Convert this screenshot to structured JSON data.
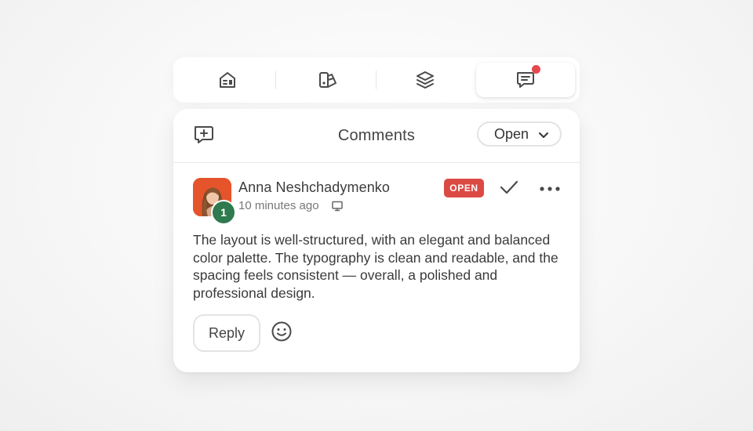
{
  "tabs": [
    {
      "name": "inbox-icon",
      "active": false
    },
    {
      "name": "swatches-icon",
      "active": false
    },
    {
      "name": "layers-icon",
      "active": false
    },
    {
      "name": "comments-icon",
      "active": true,
      "notification": true
    }
  ],
  "panel": {
    "title": "Comments",
    "filter": {
      "value": "Open"
    },
    "add_icon": "add-comment-icon"
  },
  "comment": {
    "author": "Anna Neshchadymenko",
    "avatar_badge": "1",
    "timestamp": "10 minutes ago",
    "device_icon": "monitor-icon",
    "status": "OPEN",
    "body": "The layout is well-structured, with an elegant and balanced color palette. The typography is clean and readable, and the spacing feels consistent — overall, a polished and professional design.",
    "reply_label": "Reply",
    "emoji_icon": "smiley-icon"
  },
  "colors": {
    "status_badge": "#dc4a44",
    "notification_dot": "#e5484d",
    "avatar_bg": "#e5542a",
    "avatar_badge": "#2f7a4f"
  }
}
